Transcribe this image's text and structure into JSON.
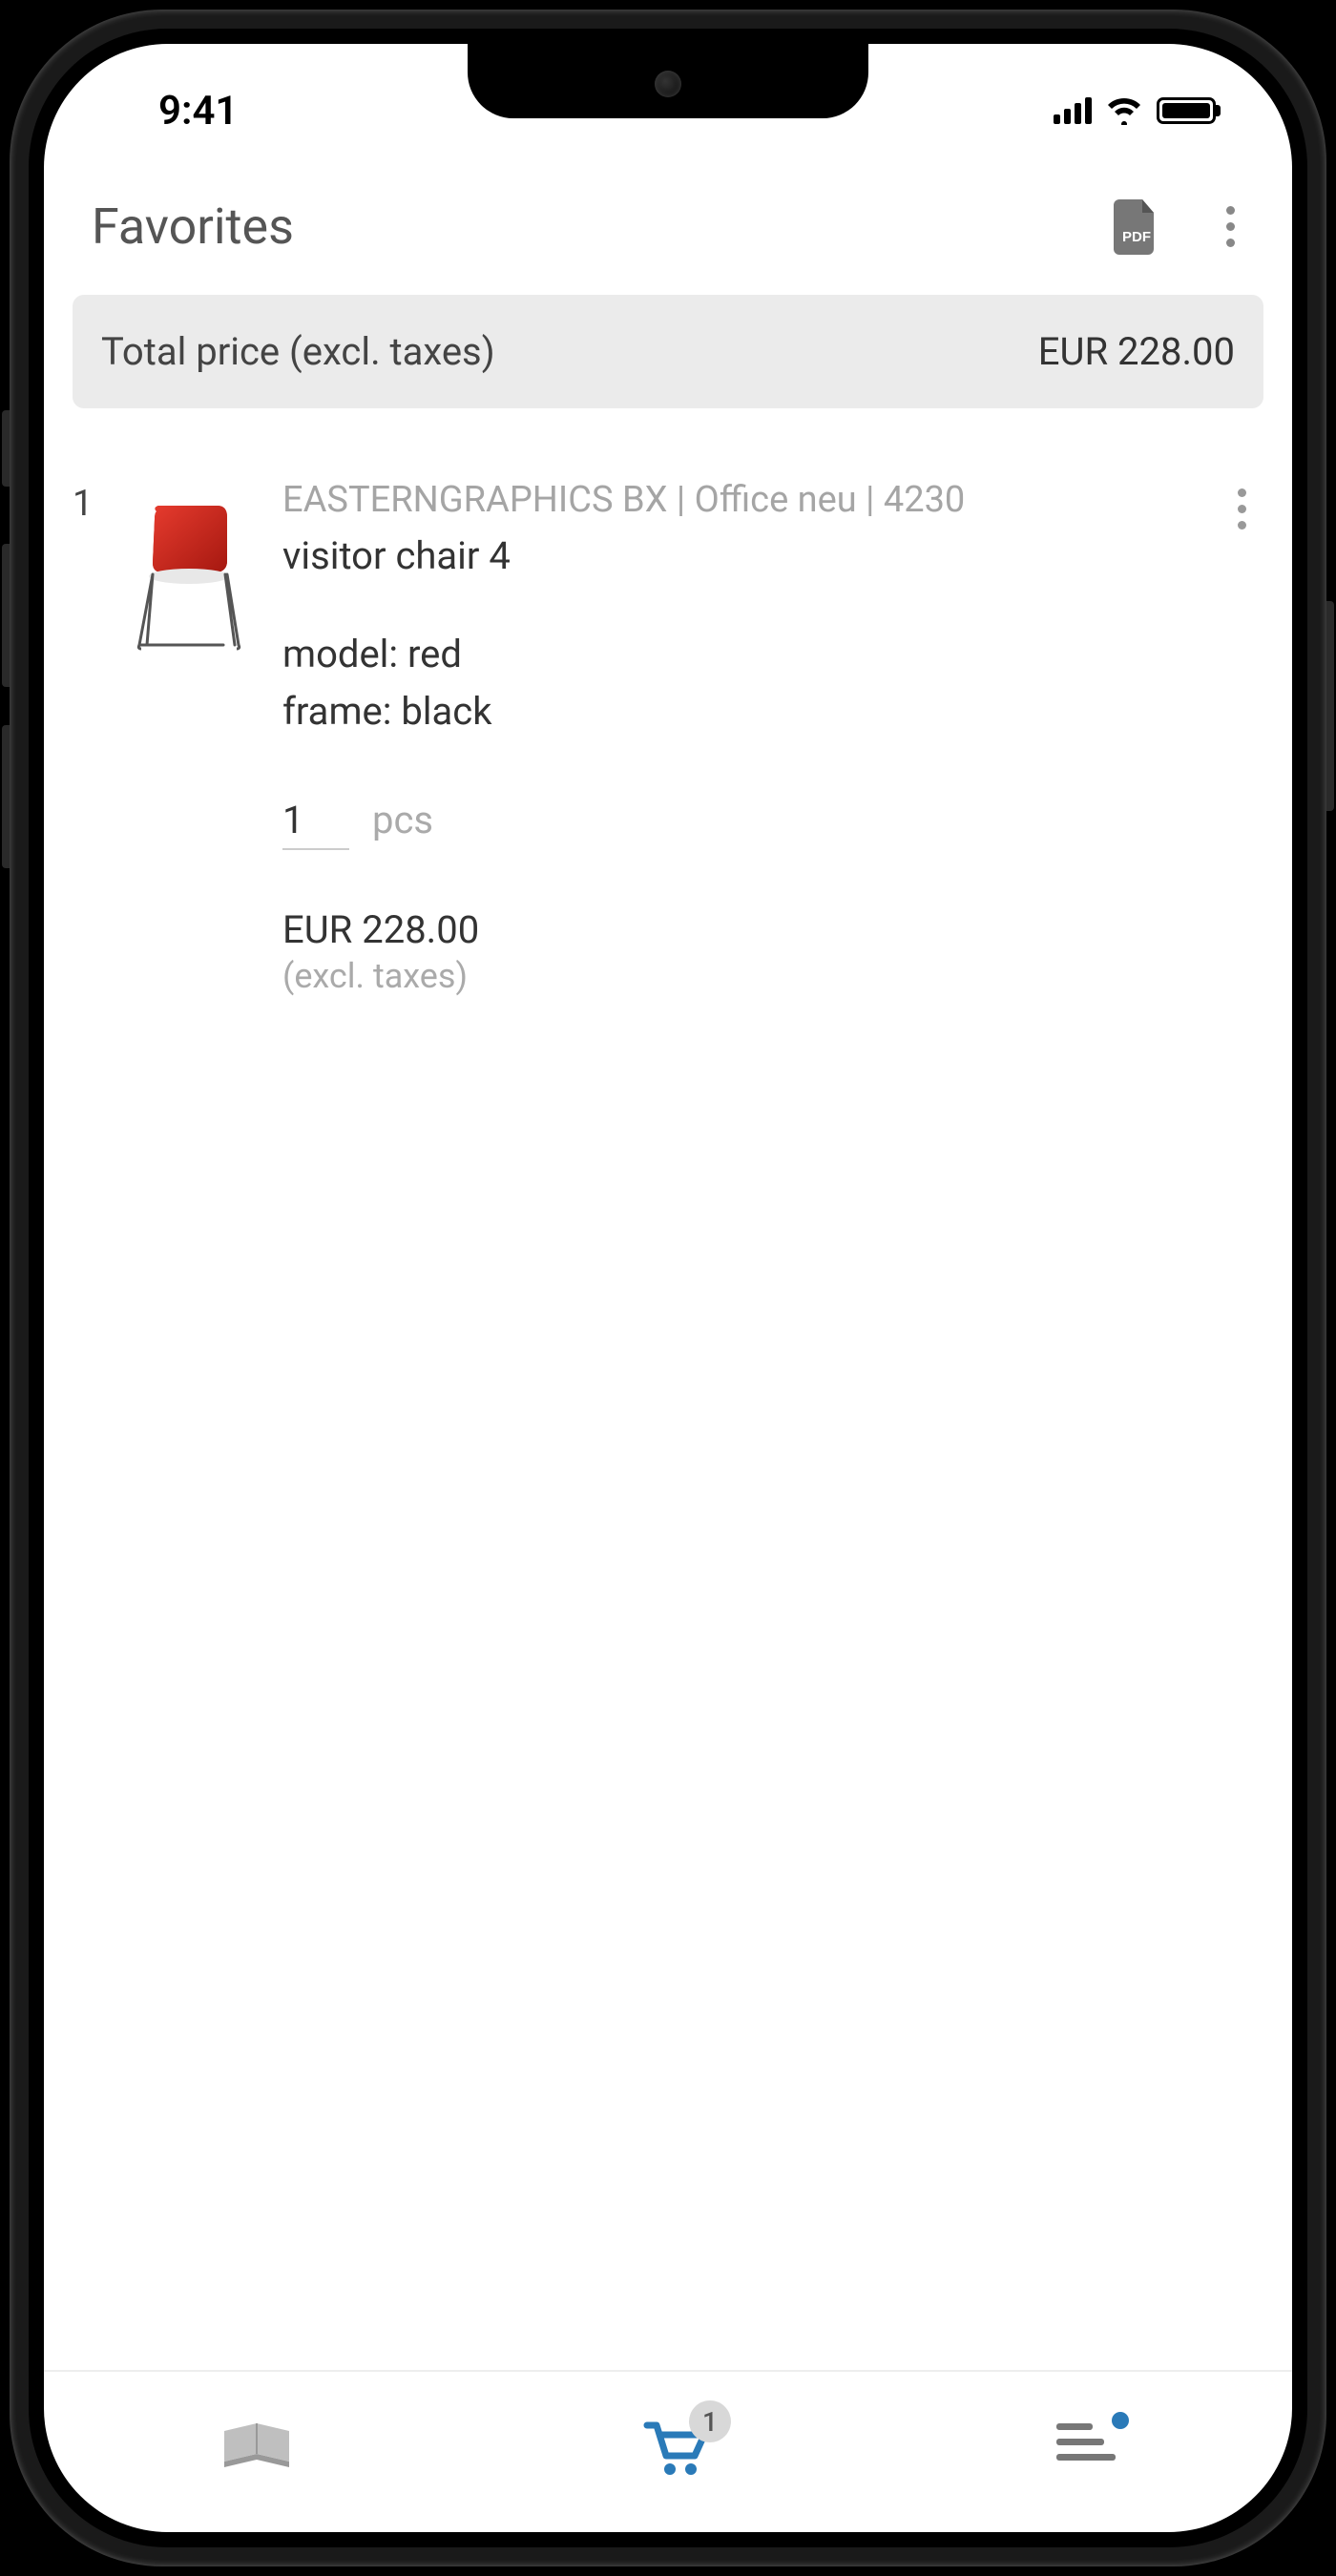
{
  "status": {
    "time": "9:41"
  },
  "header": {
    "title": "Favorites"
  },
  "total": {
    "label": "Total price (excl. taxes)",
    "value": "EUR 228.00"
  },
  "items": [
    {
      "index": "1",
      "breadcrumb": "EASTERNGRAPHICS BX | Office neu | 4230",
      "name": "visitor chair 4",
      "attr_model": "model: red",
      "attr_frame": "frame: black",
      "qty": "1",
      "qty_unit": "pcs",
      "price": "EUR 228.00",
      "price_note": "(excl. taxes)"
    }
  ],
  "nav": {
    "cart_badge": "1"
  }
}
